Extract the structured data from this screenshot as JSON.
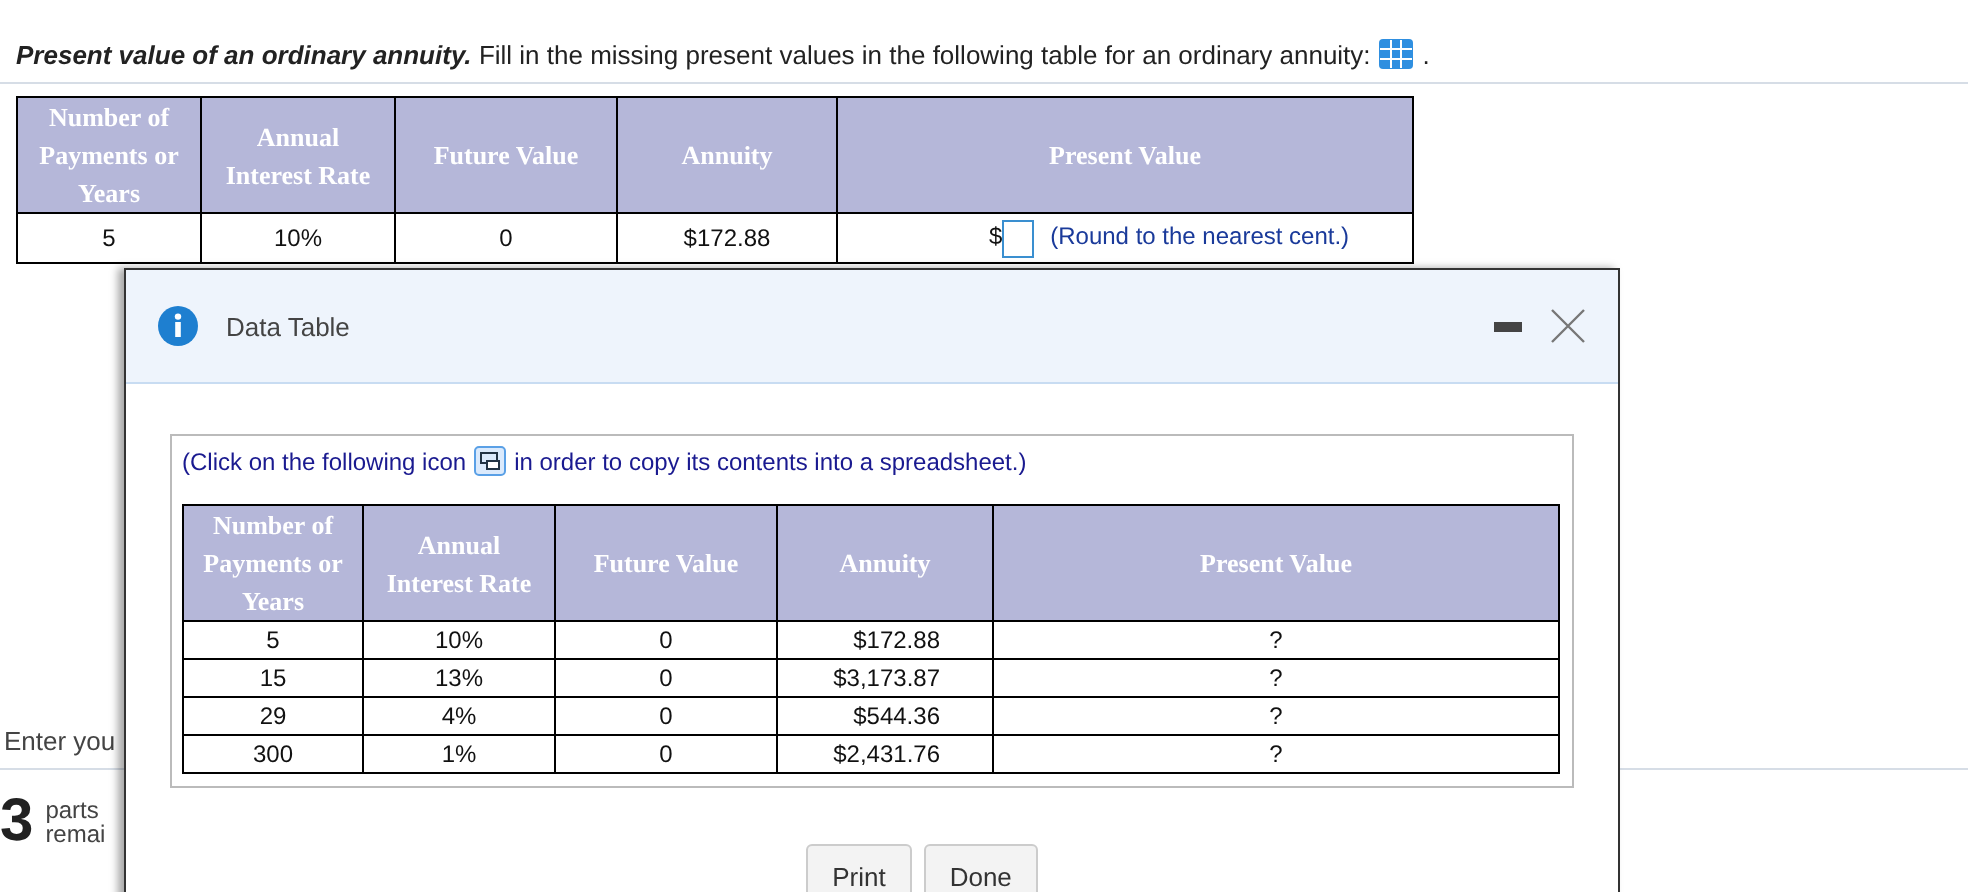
{
  "question": {
    "title": "Present value of an ordinary annuity.",
    "text": "Fill in the missing present values in the following table for an ordinary annuity:",
    "suffix": "."
  },
  "table": {
    "columns": [
      "Number of Payments or Years",
      "Annual Interest Rate",
      "Future Value",
      "Annuity",
      "Present Value"
    ],
    "rows": [
      {
        "years": "5",
        "rate": "10%",
        "future_value": "0",
        "annuity": "$172.88",
        "currency": "$",
        "hint": "(Round to the nearest cent.)"
      }
    ]
  },
  "footer": {
    "prompt": "Enter you",
    "parts_count": "3",
    "parts_text": [
      "parts",
      "remai"
    ]
  },
  "dialog": {
    "title": "Data Table",
    "instruction_before": "(Click on the following icon",
    "instruction_after": "in order to copy its contents into a spreadsheet.)",
    "columns": [
      "Number of Payments or Years",
      "Annual Interest Rate",
      "Future Value",
      "Annuity",
      "Present Value"
    ],
    "rows": [
      {
        "years": "5",
        "rate": "10%",
        "future_value": "0",
        "annuity": "$172.88",
        "present_value": "?"
      },
      {
        "years": "15",
        "rate": "13%",
        "future_value": "0",
        "annuity": "$3,173.87",
        "present_value": "?"
      },
      {
        "years": "29",
        "rate": "4%",
        "future_value": "0",
        "annuity": "$544.36",
        "present_value": "?"
      },
      {
        "years": "300",
        "rate": "1%",
        "future_value": "0",
        "annuity": "$2,431.76",
        "present_value": "?"
      }
    ],
    "buttons": [
      "Print",
      "Done"
    ]
  }
}
